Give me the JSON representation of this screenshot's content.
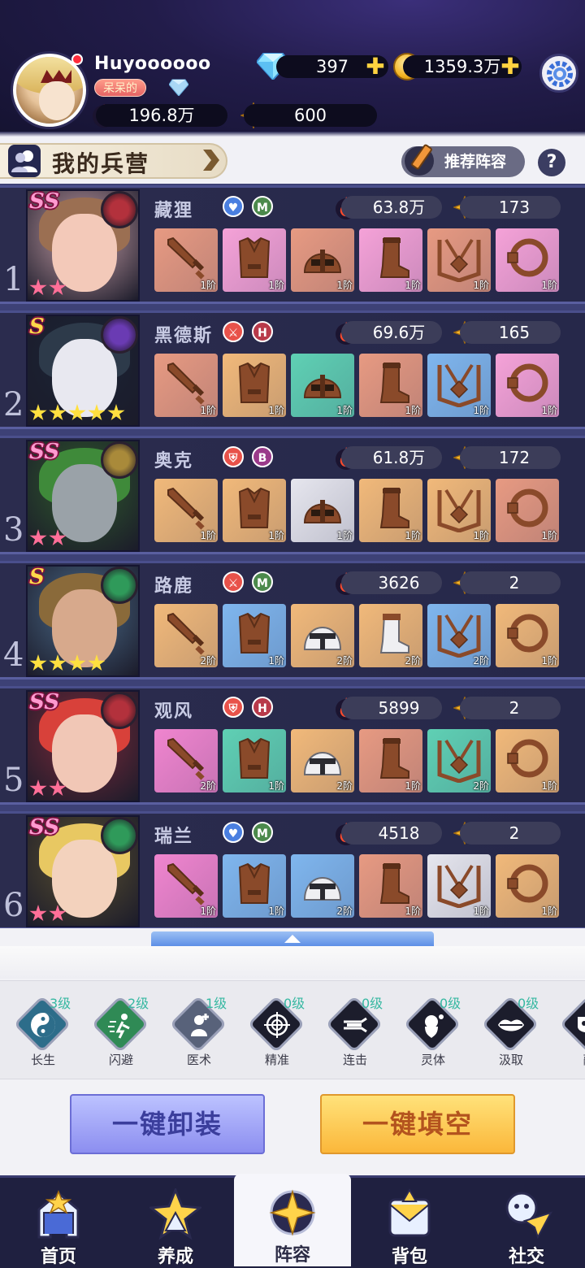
{
  "profile": {
    "username": "Huyoooooo",
    "nickname_tag": "呆呆的",
    "gems": "397",
    "gold": "1359.3万",
    "power": "196.8万",
    "stars": "600"
  },
  "barracks": {
    "title": "我的兵营",
    "recommend_label": "推荐阵容",
    "help_label": "?"
  },
  "heroes": [
    {
      "index": "1",
      "rank": "SS",
      "name": "藏狸",
      "badge1": "heart",
      "badge2": "M",
      "power": "63.8万",
      "stars_value": "173",
      "star_count": 2,
      "element_color": "#b3313c",
      "skin": "#f3c9b9",
      "hair": "#9b6f52",
      "bg": "#c9a0a8",
      "equipment": [
        {
          "type": "sword",
          "tier": "1阶",
          "color": "#e79a82"
        },
        {
          "type": "armor",
          "tier": "1阶",
          "color": "#f5a2d8"
        },
        {
          "type": "helmet",
          "tier": "1阶",
          "color": "#e79a82"
        },
        {
          "type": "boot",
          "tier": "1阶",
          "color": "#f5a2d8"
        },
        {
          "type": "amulet",
          "tier": "1阶",
          "color": "#e79a82"
        },
        {
          "type": "ring",
          "tier": "1阶",
          "color": "#f5a2d8"
        }
      ]
    },
    {
      "index": "2",
      "rank": "S",
      "name": "黑德斯",
      "badge1": "sword",
      "badge2": "H",
      "power": "69.6万",
      "stars_value": "165",
      "star_count": 5,
      "element_color": "#6a3bb3",
      "skin": "#e8e8f0",
      "hair": "#2d3a4a",
      "bg": "#1b2435",
      "equipment": [
        {
          "type": "sword",
          "tier": "1阶",
          "color": "#e79a82"
        },
        {
          "type": "armor",
          "tier": "1阶",
          "color": "#f1b97a"
        },
        {
          "type": "helmet",
          "tier": "1阶",
          "color": "#5fd0b4"
        },
        {
          "type": "boot",
          "tier": "1阶",
          "color": "#e79a82"
        },
        {
          "type": "amulet",
          "tier": "1阶",
          "color": "#7fb6ee"
        },
        {
          "type": "ring",
          "tier": "1阶",
          "color": "#f5a2d8"
        }
      ]
    },
    {
      "index": "3",
      "rank": "SS",
      "name": "奥克",
      "badge1": "shield",
      "badge2": "B",
      "power": "61.8万",
      "stars_value": "172",
      "star_count": 2,
      "element_color": "#a98a3a",
      "skin": "#9aa2a8",
      "hair": "#3f8a3a",
      "bg": "#2f5a2c",
      "equipment": [
        {
          "type": "sword",
          "tier": "1阶",
          "color": "#f1b97a"
        },
        {
          "type": "armor",
          "tier": "1阶",
          "color": "#f1b97a"
        },
        {
          "type": "helmet",
          "tier": "1阶",
          "color": "#e6e6ee"
        },
        {
          "type": "boot",
          "tier": "1阶",
          "color": "#f1b97a"
        },
        {
          "type": "amulet",
          "tier": "1阶",
          "color": "#f1b97a"
        },
        {
          "type": "ring",
          "tier": "1阶",
          "color": "#e79a82"
        }
      ]
    },
    {
      "index": "4",
      "rank": "S",
      "name": "路鹿",
      "badge1": "sword",
      "badge2": "M",
      "power": "3626",
      "stars_value": "2",
      "star_count": 4,
      "element_color": "#2f9a5a",
      "skin": "#d7a98c",
      "hair": "#8a6a3a",
      "bg": "#4a6a88",
      "equipment": [
        {
          "type": "sword",
          "tier": "2阶",
          "color": "#f1b97a"
        },
        {
          "type": "armor",
          "tier": "1阶",
          "color": "#7fb6ee"
        },
        {
          "type": "helmet-white",
          "tier": "2阶",
          "color": "#f1b97a"
        },
        {
          "type": "boot-white",
          "tier": "2阶",
          "color": "#f1b97a"
        },
        {
          "type": "amulet",
          "tier": "2阶",
          "color": "#7fb6ee"
        },
        {
          "type": "ring",
          "tier": "1阶",
          "color": "#f1b97a"
        }
      ]
    },
    {
      "index": "5",
      "rank": "SS",
      "name": "观风",
      "badge1": "shield",
      "badge2": "H",
      "power": "5899",
      "stars_value": "2",
      "star_count": 2,
      "element_color": "#b3313c",
      "skin": "#f1c7b6",
      "hair": "#d8413a",
      "bg": "#7d2a3a",
      "equipment": [
        {
          "type": "sword",
          "tier": "2阶",
          "color": "#f085cf"
        },
        {
          "type": "armor",
          "tier": "1阶",
          "color": "#5fd0b4"
        },
        {
          "type": "helmet-white",
          "tier": "2阶",
          "color": "#f1b97a"
        },
        {
          "type": "boot",
          "tier": "1阶",
          "color": "#e79a82"
        },
        {
          "type": "amulet",
          "tier": "2阶",
          "color": "#5fd0b4"
        },
        {
          "type": "ring",
          "tier": "1阶",
          "color": "#f1b97a"
        }
      ]
    },
    {
      "index": "6",
      "rank": "SS",
      "name": "瑞兰",
      "badge1": "heart",
      "badge2": "M",
      "power": "4518",
      "stars_value": "2",
      "star_count": 2,
      "element_color": "#2f9a5a",
      "skin": "#f3d2bd",
      "hair": "#e8c862",
      "bg": "#5a5030",
      "equipment": [
        {
          "type": "sword",
          "tier": "1阶",
          "color": "#f085cf"
        },
        {
          "type": "armor",
          "tier": "1阶",
          "color": "#7fb6ee"
        },
        {
          "type": "helmet-white",
          "tier": "2阶",
          "color": "#7fb6ee"
        },
        {
          "type": "boot",
          "tier": "1阶",
          "color": "#e79a82"
        },
        {
          "type": "amulet",
          "tier": "1阶",
          "color": "#e6e6ee"
        },
        {
          "type": "ring",
          "tier": "1阶",
          "color": "#f1b97a"
        }
      ]
    }
  ],
  "skills": [
    {
      "label": "长生",
      "level": "3级",
      "icon": "yin-yang-icon",
      "color": "#2d6d8a"
    },
    {
      "label": "闪避",
      "level": "2级",
      "icon": "dodge-icon",
      "color": "#2f8a55"
    },
    {
      "label": "医术",
      "level": "1级",
      "icon": "medicine-icon",
      "color": "#58627a"
    },
    {
      "label": "精准",
      "level": "0级",
      "icon": "crosshair-icon",
      "color": "#1c1d2c"
    },
    {
      "label": "连击",
      "level": "0级",
      "icon": "combo-icon",
      "color": "#1c1d2c"
    },
    {
      "label": "灵体",
      "level": "0级",
      "icon": "spirit-icon",
      "color": "#1c1d2c"
    },
    {
      "label": "汲取",
      "level": "0级",
      "icon": "lips-icon",
      "color": "#1c1d2c"
    },
    {
      "label": "蔽",
      "level": "",
      "icon": "mask-icon",
      "color": "#1c1d2c"
    }
  ],
  "actions": {
    "unequip_all": "一键卸装",
    "fill_empty": "一键填空"
  },
  "nav": [
    {
      "label": "首页",
      "icon": "home-icon"
    },
    {
      "label": "养成",
      "icon": "train-icon"
    },
    {
      "label": "阵容",
      "icon": "lineup-icon"
    },
    {
      "label": "背包",
      "icon": "bag-icon"
    },
    {
      "label": "社交",
      "icon": "social-icon"
    }
  ]
}
